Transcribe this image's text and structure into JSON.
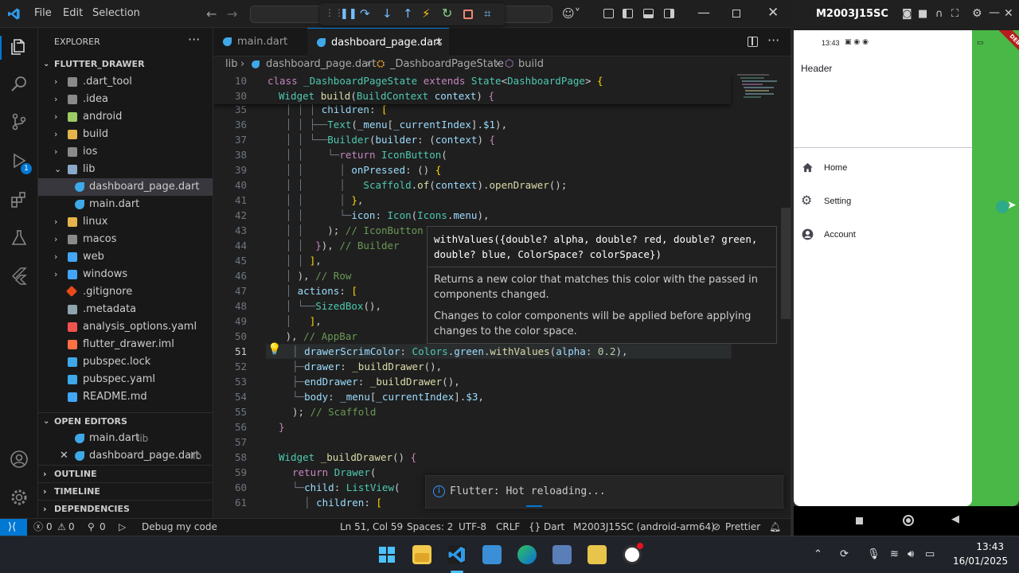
{
  "titlebar": {
    "menus": [
      "File",
      "Edit",
      "Selection"
    ]
  },
  "explorer": {
    "title": "EXPLORER",
    "project": "FLUTTER_DRAWER",
    "items": [
      {
        "label": ".dart_tool",
        "type": "folder"
      },
      {
        "label": ".idea",
        "type": "folder"
      },
      {
        "label": "android",
        "type": "folder"
      },
      {
        "label": "build",
        "type": "folder"
      },
      {
        "label": "ios",
        "type": "folder"
      },
      {
        "label": "lib",
        "type": "folder-open"
      },
      {
        "label": "dashboard_page.dart",
        "type": "dart"
      },
      {
        "label": "main.dart",
        "type": "dart"
      },
      {
        "label": "linux",
        "type": "folder"
      },
      {
        "label": "macos",
        "type": "folder"
      },
      {
        "label": "web",
        "type": "folder"
      },
      {
        "label": "windows",
        "type": "folder"
      },
      {
        "label": ".gitignore",
        "type": "git"
      },
      {
        "label": ".metadata",
        "type": "meta"
      },
      {
        "label": "analysis_options.yaml",
        "type": "yaml"
      },
      {
        "label": "flutter_drawer.iml",
        "type": "iml"
      },
      {
        "label": "pubspec.lock",
        "type": "lock"
      },
      {
        "label": "pubspec.yaml",
        "type": "yaml"
      },
      {
        "label": "README.md",
        "type": "md"
      }
    ],
    "open_editors_title": "OPEN EDITORS",
    "open_editors": [
      {
        "label": "main.dart",
        "folder": "lib"
      },
      {
        "label": "dashboard_page.dart",
        "folder": "lib"
      }
    ],
    "outline": "OUTLINE",
    "timeline": "TIMELINE",
    "dependencies": "DEPENDENCIES"
  },
  "tabs": [
    {
      "label": "main.dart",
      "active": false
    },
    {
      "label": "dashboard_page.dart",
      "active": true
    }
  ],
  "breadcrumb": {
    "folder": "lib",
    "file": "dashboard_page.dart",
    "class": "_DashboardPageState",
    "method": "build"
  },
  "editor": {
    "line_numbers": [
      "10",
      "30",
      "35",
      "36",
      "37",
      "38",
      "39",
      "40",
      "41",
      "42",
      "43",
      "44",
      "45",
      "46",
      "47",
      "48",
      "49",
      "50",
      "51",
      "52",
      "53",
      "54",
      "55",
      "56",
      "57",
      "58",
      "59",
      "60",
      "61"
    ],
    "hover": {
      "signature_1": "withValues({double? alpha, double? red, double? green,",
      "signature_2": "double? blue, ColorSpace? colorSpace})",
      "desc_1": "Returns a new color that matches this color with the passed in",
      "desc_2": "components changed.",
      "desc_3": "Changes to color components will be applied before applying",
      "desc_4": "changes to the color space."
    }
  },
  "toast": {
    "message": "Flutter: Hot reloading..."
  },
  "statusbar": {
    "errors": "0",
    "warnings": "0",
    "ports": "0",
    "debug": "Debug my code",
    "position": "Ln 51, Col 59",
    "spaces": "Spaces: 2",
    "encoding": "UTF-8",
    "eol": "CRLF",
    "language": "Dart",
    "device": "M2003J15SC (android-arm64)",
    "formatter": "Prettier"
  },
  "emulator": {
    "device": "M2003J15SC",
    "time": "13:43",
    "debug_banner": "DEBUG",
    "drawer_header": "Header",
    "nav": [
      {
        "label": "Home",
        "icon": "home-icon"
      },
      {
        "label": "Setting",
        "icon": "settings-icon"
      },
      {
        "label": "Account",
        "icon": "account-icon"
      }
    ]
  },
  "taskbar": {
    "time": "13:43",
    "date": "16/01/2025"
  },
  "colors": {
    "accent": "#0078d4",
    "green": "#49b846",
    "editor_bg": "#1f1f1f"
  }
}
